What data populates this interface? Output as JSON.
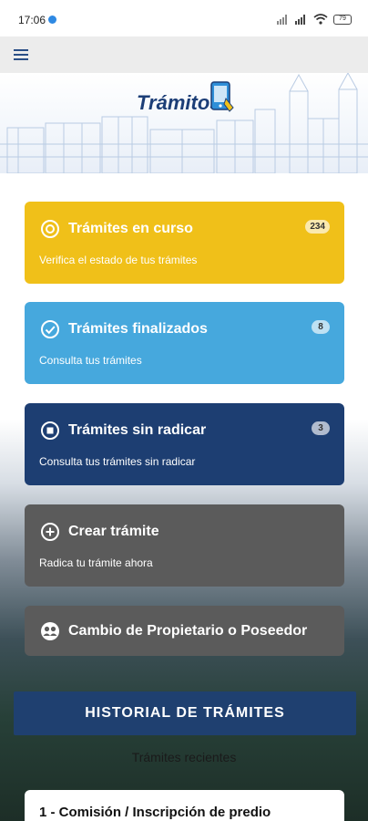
{
  "status_bar": {
    "time": "17:06",
    "battery": "79"
  },
  "app_bar": {
    "menu_icon": "hamburger-menu-icon"
  },
  "header": {
    "logo_text": "Trámitos"
  },
  "cards": [
    {
      "title": "Trámites en curso",
      "subtitle": "Verifica el estado de tus trámites",
      "badge": "234",
      "icon": "circle-dot-icon",
      "color": "#f0c019"
    },
    {
      "title": "Trámites finalizados",
      "subtitle": "Consulta tus trámites",
      "badge": "8",
      "icon": "check-circle-icon",
      "color": "#46a8dd"
    },
    {
      "title": "Trámites sin radicar",
      "subtitle": "Consulta tus trámites sin radicar",
      "badge": "3",
      "icon": "stop-circle-icon",
      "color": "#1d3e72"
    },
    {
      "title": "Crear trámite",
      "subtitle": "Radica tu trámite ahora",
      "icon": "plus-circle-icon",
      "color": "#5b5b5b"
    },
    {
      "title": "Cambio de Propietario o Poseedor",
      "icon": "people-icon",
      "color": "#5b5b5b"
    }
  ],
  "history_button": "HISTORIAL DE TRÁMITES",
  "recent": {
    "label": "Trámites recientes",
    "items": [
      "1 - Comisión / Inscripción de predio"
    ]
  }
}
